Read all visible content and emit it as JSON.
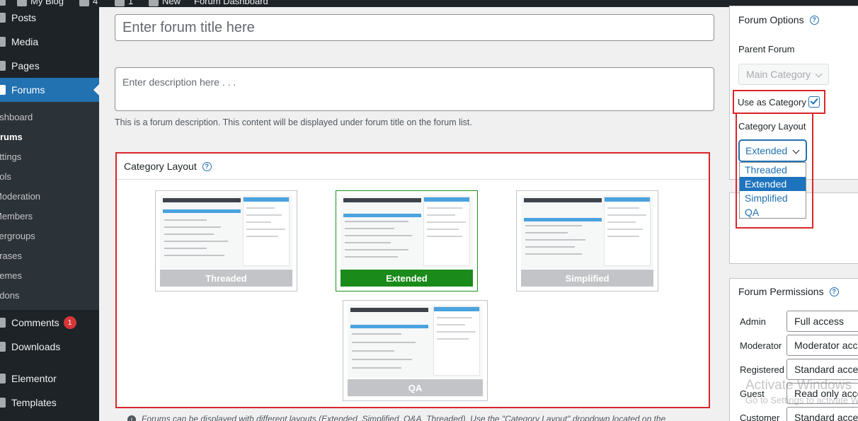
{
  "adminbar": {
    "site_name": "My Blog",
    "updates_count": "4",
    "comments_count": "1",
    "new_label": "New",
    "forum_dashboard": "Forum Dashboard"
  },
  "sidebar": {
    "items": [
      {
        "label": "Posts"
      },
      {
        "label": "Media"
      },
      {
        "label": "Pages"
      },
      {
        "label": "Forums"
      },
      {
        "label": "Comments",
        "badge": "1"
      },
      {
        "label": "Downloads"
      },
      {
        "label": "Elementor"
      },
      {
        "label": "Templates"
      }
    ],
    "submenu": [
      "ashboard",
      "orums",
      "ettings",
      "ools",
      "Moderation",
      "Members",
      "sergroups",
      "hrases",
      "hemes",
      "ddons"
    ]
  },
  "editor": {
    "title_placeholder": "Enter forum title here",
    "description_placeholder": "Enter description here . . .",
    "description_help": "This is a forum description. This content will be displayed under forum title on the forum list."
  },
  "layout_box": {
    "title": "Category Layout",
    "help": "?",
    "cards": [
      {
        "label": "Threaded"
      },
      {
        "label": "Extended"
      },
      {
        "label": "Simplified"
      },
      {
        "label": "QA"
      }
    ],
    "selected": "Extended",
    "info_text": "Forums can be displayed with different layouts (Extended, Simplified, Q&A, Threaded). Use the \"Category Layout\" dropdown located on the"
  },
  "forum_options": {
    "title": "Forum Options",
    "parent_forum_label": "Parent Forum",
    "parent_forum_value": "Main Category",
    "use_as_category_label": "Use as Category",
    "use_as_category_checked": true,
    "category_layout_label": "Category Layout",
    "category_layout_value": "Extended",
    "options": [
      "Threaded",
      "Extended",
      "Simplified",
      "QA"
    ]
  },
  "forum_permissions": {
    "title": "Forum Permissions",
    "rows": [
      {
        "role": "Admin",
        "value": "Full access"
      },
      {
        "role": "Moderator",
        "value": "Moderator access"
      },
      {
        "role": "Registered",
        "value": "Standard access"
      },
      {
        "role": "Guest",
        "value": "Read only access"
      },
      {
        "role": "Customer",
        "value": "Standard access"
      }
    ]
  },
  "watermark": {
    "line1": "Activate Windows",
    "line2": "Go to Settings to activate Windows."
  },
  "colors": {
    "admin_dark": "#1d2327",
    "accent_blue": "#2271b1",
    "highlight_red": "#d9262b",
    "selected_green": "#1a8a1a"
  }
}
